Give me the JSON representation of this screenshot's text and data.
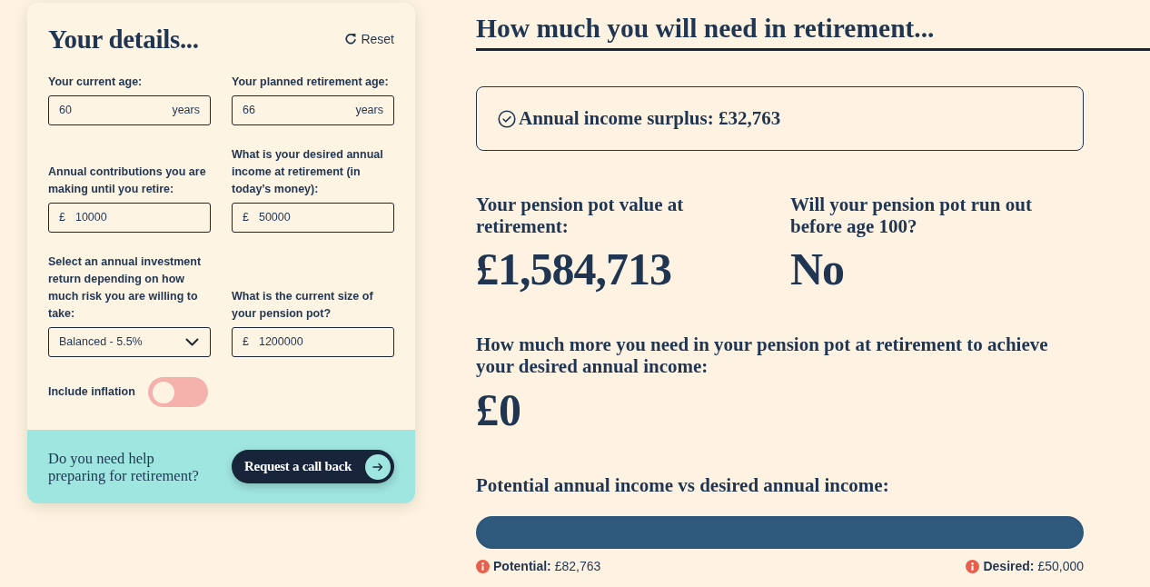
{
  "details_panel": {
    "title": "Your details...",
    "reset": "Reset",
    "field_rows": [
      [
        {
          "kind": "suffix",
          "label": "Your current age:",
          "value": "60",
          "unit": "years"
        },
        {
          "kind": "suffix",
          "label": "Your planned retirement age:",
          "value": "66",
          "unit": "years"
        }
      ],
      [
        {
          "kind": "prefix",
          "label": "Annual contributions you are making until you retire:",
          "unit": "£",
          "value": "10000"
        },
        {
          "kind": "prefix",
          "label": "What is your desired annual income at retirement (in today’s money):",
          "unit": "£",
          "value": "50000"
        }
      ],
      [
        {
          "kind": "select",
          "label": "Select an annual investment return depending on how much risk you are willing to take:",
          "value": "Balanced - 5.5%"
        },
        {
          "kind": "prefix",
          "label": "What is the current size of your pension pot?",
          "unit": "£",
          "value": "1200000"
        }
      ]
    ],
    "inflation": {
      "label": "Include inflation",
      "on": false
    },
    "help": {
      "text": "Do you need help preparing for retirement?",
      "button": "Request a call back"
    }
  },
  "results": {
    "heading": "How much you will need in retirement...",
    "status": "Annual income surplus: £32,763",
    "stats": [
      {
        "label": "Your pension pot value at retirement:",
        "value": "£1,584,713"
      },
      {
        "label": "Will your pension pot run out before age 100?",
        "value": "No"
      }
    ],
    "shortfall": {
      "label": "How much more you need in your pension pot at retirement to achieve your desired annual income:",
      "value": "£0"
    },
    "comparison": {
      "title": "Potential annual income vs desired annual income:",
      "level": 1,
      "legend": [
        "**Potential:** £82,763",
        "**Desired:** £50,000"
      ]
    }
  }
}
